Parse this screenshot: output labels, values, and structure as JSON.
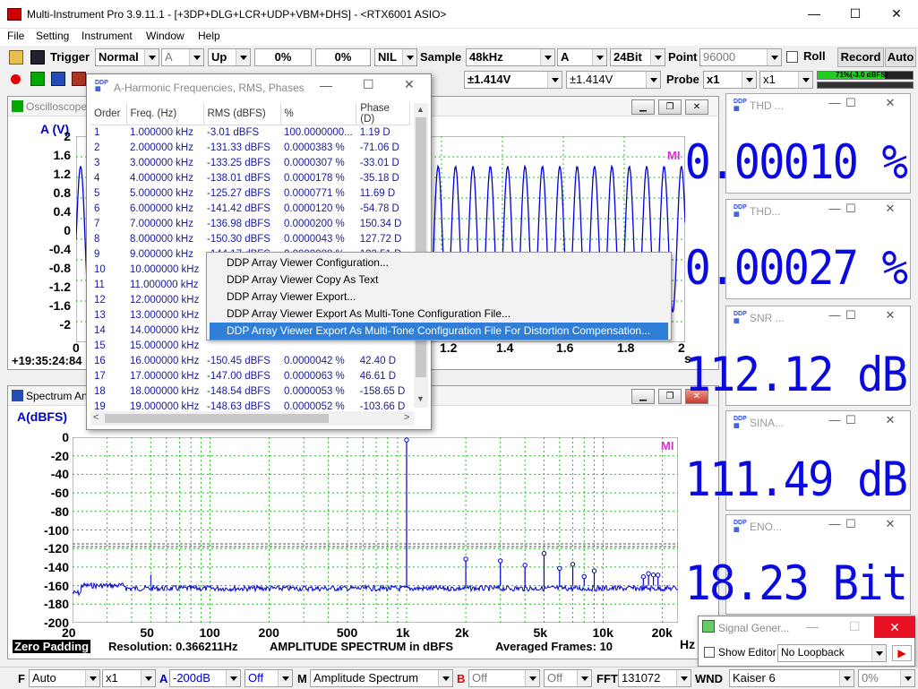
{
  "app": {
    "title": "Multi-Instrument Pro 3.9.11.1  -  [+3DP+DLG+LCR+UDP+VBM+DHS]  -  <RTX6001 ASIO>",
    "minimize": "—",
    "maximize": "☐",
    "close": "✕"
  },
  "menu": [
    "File",
    "Setting",
    "Instrument",
    "Window",
    "Help"
  ],
  "toolbar1": {
    "trigger_label": "Trigger",
    "trigger_mode": "Normal",
    "trigger_channel": "A",
    "trigger_edge": "Up",
    "level1": "0%",
    "level2": "0%",
    "nil": "NIL",
    "sample_label": "Sample",
    "sample_rate": "48kHz",
    "channel": "A",
    "bits": "24Bit",
    "point_label": "Point",
    "point_value": "96000",
    "roll_label": "Roll",
    "record_label": "Record",
    "auto_label": "Auto"
  },
  "toolbar2": {
    "range_a": "±1.414V",
    "range_b": "±1.414V",
    "probe_label": "Probe",
    "probe_a": "x1",
    "probe_b": "x1",
    "level_meter": "71%(-3.0 dBFS)"
  },
  "oscilloscope": {
    "title": "Oscilloscope",
    "yunit": "A (V)",
    "yticks": [
      "2",
      "1.6",
      "1.2",
      "0.8",
      "0.4",
      "0",
      "-0.4",
      "-0.8",
      "-1.2",
      "-1.6",
      "-2"
    ],
    "xticks": [
      "0",
      "1.2",
      "1.4",
      "1.6",
      "1.8",
      "2"
    ],
    "xunit": "s",
    "timestamp": "+19:35:24:84"
  },
  "spectrum": {
    "title": "Spectrum Analyzer",
    "yunit": "A(dBFS)",
    "yticks": [
      "0",
      "-20",
      "-40",
      "-60",
      "-80",
      "-100",
      "-120",
      "-140",
      "-160",
      "-180",
      "-200"
    ],
    "xticks": [
      "20",
      "50",
      "100",
      "200",
      "500",
      "1k",
      "2k",
      "5k",
      "10k",
      "20k"
    ],
    "xunit": "Hz",
    "zero_padding": "Zero Padding",
    "resolution": "Resolution: 0.366211Hz",
    "caption": "AMPLITUDE SPECTRUM in dBFS",
    "averaged": "Averaged Frames: 10",
    "mark": "MI"
  },
  "harmonics": {
    "title": "A-Harmonic Frequencies, RMS, Phases",
    "columns": [
      "Order",
      "Freq. (Hz)",
      "RMS (dBFS)",
      "%",
      "Phase (D)"
    ],
    "rows": [
      [
        "1",
        "1.000000 kHz",
        "-3.01 dBFS",
        "100.0000000...",
        "1.19  D"
      ],
      [
        "2",
        "2.000000 kHz",
        "-131.33 dBFS",
        "0.0000383  %",
        "-71.06  D"
      ],
      [
        "3",
        "3.000000 kHz",
        "-133.25 dBFS",
        "0.0000307  %",
        "-33.01  D"
      ],
      [
        "4",
        "4.000000 kHz",
        "-138.01 dBFS",
        "0.0000178  %",
        "-35.18  D"
      ],
      [
        "5",
        "5.000000 kHz",
        "-125.27 dBFS",
        "0.0000771  %",
        "11.69  D"
      ],
      [
        "6",
        "6.000000 kHz",
        "-141.42 dBFS",
        "0.0000120  %",
        "-54.78  D"
      ],
      [
        "7",
        "7.000000 kHz",
        "-136.98 dBFS",
        "0.0000200  %",
        "150.34  D"
      ],
      [
        "8",
        "8.000000 kHz",
        "-150.30 dBFS",
        "0.0000043  %",
        "127.72  D"
      ],
      [
        "9",
        "9.000000 kHz",
        "-144.17 dBFS",
        "0.0000088  %",
        "132.51  D"
      ],
      [
        "10",
        "10.000000 kHz",
        "",
        "",
        ""
      ],
      [
        "11",
        "11.000000 kHz",
        "",
        "",
        ""
      ],
      [
        "12",
        "12.000000 kHz",
        "",
        "",
        ""
      ],
      [
        "13",
        "13.000000 kHz",
        "",
        "",
        ""
      ],
      [
        "14",
        "14.000000 kHz",
        "",
        "",
        ""
      ],
      [
        "15",
        "15.000000 kHz",
        "",
        "",
        ""
      ],
      [
        "16",
        "16.000000 kHz",
        "-150.45 dBFS",
        "0.0000042  %",
        "42.40  D"
      ],
      [
        "17",
        "17.000000 kHz",
        "-147.00 dBFS",
        "0.0000063  %",
        "46.61  D"
      ],
      [
        "18",
        "18.000000 kHz",
        "-148.54 dBFS",
        "0.0000053  %",
        "-158.65  D"
      ],
      [
        "19",
        "19.000000 kHz",
        "-148.63 dBFS",
        "0.0000052  %",
        "-103.66  D"
      ]
    ]
  },
  "context_menu": [
    "DDP Array Viewer Configuration...",
    "DDP Array Viewer Copy As Text",
    "DDP Array Viewer Export...",
    "DDP Array Viewer Export As Multi-Tone Configuration File...",
    "DDP Array Viewer Export As Multi-Tone Configuration File For Distortion Compensation..."
  ],
  "meters": [
    {
      "title": "THD ...",
      "value": "0.00010 %"
    },
    {
      "title": "THD...",
      "value": "0.00027 %"
    },
    {
      "title": "SNR ...",
      "value": "112.12 dB"
    },
    {
      "title": "SINA...",
      "value": "111.49 dB"
    },
    {
      "title": "ENO...",
      "value": "18.23 Bit"
    }
  ],
  "signal_generator": {
    "title": "Signal Gener...",
    "show_editor": "Show Editor",
    "loopback": "No Loopback"
  },
  "statusbar": {
    "f": "F",
    "f_mode": "Auto",
    "mult": "x1",
    "a": "A",
    "a_range": "-200dB",
    "off1": "Off",
    "m": "M",
    "m_mode": "Amplitude Spectrum",
    "b": "B",
    "off2": "Off",
    "off3": "Off",
    "fft": "FFT",
    "fft_size": "131072",
    "wnd": "WND",
    "window": "Kaiser 6",
    "percent": "0%"
  },
  "chart_data": [
    {
      "type": "line",
      "title": "",
      "xlabel": "s",
      "ylabel": "A (V)",
      "ylim": [
        -2,
        2
      ],
      "series": [
        {
          "values": []
        }
      ]
    },
    {
      "type": "line",
      "title": "AMPLITUDE SPECTRUM in dBFS",
      "xlabel": "Hz",
      "ylabel": "A(dBFS)",
      "xlim": [
        20,
        24000
      ],
      "ylim": [
        -200,
        0
      ],
      "peaks": [
        {
          "x": 1000,
          "y": -3.01
        },
        {
          "x": 2000,
          "y": -131.33
        },
        {
          "x": 3000,
          "y": -133.25
        },
        {
          "x": 4000,
          "y": -138.01
        },
        {
          "x": 5000,
          "y": -125.27
        },
        {
          "x": 6000,
          "y": -141.42
        },
        {
          "x": 7000,
          "y": -136.98
        },
        {
          "x": 8000,
          "y": -150.3
        },
        {
          "x": 9000,
          "y": -144.17
        },
        {
          "x": 16000,
          "y": -150.45
        },
        {
          "x": 17000,
          "y": -147.0
        },
        {
          "x": 18000,
          "y": -148.54
        },
        {
          "x": 19000,
          "y": -148.63
        }
      ],
      "noise_floor": -160
    }
  ]
}
